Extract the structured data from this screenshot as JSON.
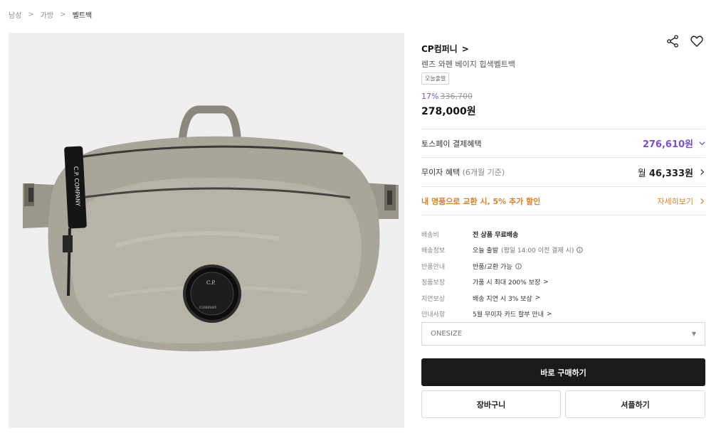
{
  "breadcrumb": [
    "남성",
    "가방",
    "벨트백"
  ],
  "product": {
    "image_alt": "C.P. COMPANY",
    "brand": "CP컴퍼니",
    "name": "렌즈 와펜 베이지 힙색벨트백",
    "badge": "오늘출발",
    "discount": "17%",
    "original_price": "336,700",
    "price": "278,000원"
  },
  "benefits": {
    "tosspay_label": "토스페이 결제혜택",
    "tosspay_price": "276,610원",
    "installment_label": "무이자 혜택",
    "installment_note": "(6개월 기준)",
    "installment_prefix": "월",
    "installment_value": "46,333원",
    "exchange_label": "내 명품으로 교환 시, 5% 추가 할인",
    "exchange_link": "자세히보기"
  },
  "details": [
    {
      "label": "배송비",
      "value": "전 상품 무료배송"
    },
    {
      "label": "배송정보",
      "value": "오늘 출발",
      "note": "(평일 14:00 이전 결제 시)"
    },
    {
      "label": "반품안내",
      "value": "반품/교환 가능"
    },
    {
      "label": "정품보장",
      "value": "가품 시 최대 200% 보장"
    },
    {
      "label": "지연보상",
      "value": "배송 지연 시 3% 보상"
    },
    {
      "label": "안내사항",
      "value": "5월 무이자 카드 할부 안내"
    }
  ],
  "option": {
    "selected": "ONESIZE"
  },
  "actions": {
    "buy": "바로 구매하기",
    "cart": "장바구니",
    "share": "셔플하기"
  },
  "colors": {
    "accent": "#7b4ecf",
    "orange": "#d9822b",
    "button_dark": "#1a1a1a"
  },
  "icons": {
    "share": "share-icon",
    "wishlist": "heart-icon"
  }
}
